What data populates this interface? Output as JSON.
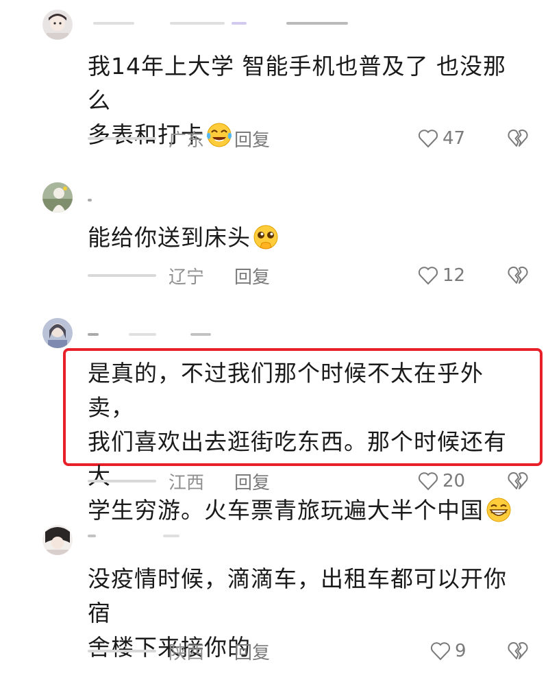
{
  "comments": [
    {
      "text_lines": [
        "我14年上大学 智能手机也普及了 也没那么",
        "多表和打卡"
      ],
      "emoji": "laughing-tears-emoji",
      "location": "广东",
      "reply_label": "回复",
      "likes": "47"
    },
    {
      "text_lines": [
        "能给你送到床头"
      ],
      "emoji": "pleading-hand-emoji",
      "location": "辽宁",
      "reply_label": "回复",
      "likes": "12"
    },
    {
      "text_lines": [
        "是真的，不过我们那个时候不太在乎外卖，",
        "我们喜欢出去逛街吃东西。那个时候还有大",
        "学生穷游。火车票青旅玩遍大半个中国"
      ],
      "emoji": "grinning-emoji",
      "location": "江西",
      "reply_label": "回复",
      "likes": "20",
      "highlighted": true,
      "highlight_color": "#e8202a"
    },
    {
      "text_lines": [
        "没疫情时候，滴滴车，出租车都可以开你宿",
        "舍楼下来接你的"
      ],
      "location": "陕西",
      "reply_label": "回复",
      "likes": "9"
    }
  ],
  "icons": {
    "like": "heart-outline-icon",
    "dislike": "broken-heart-icon"
  }
}
